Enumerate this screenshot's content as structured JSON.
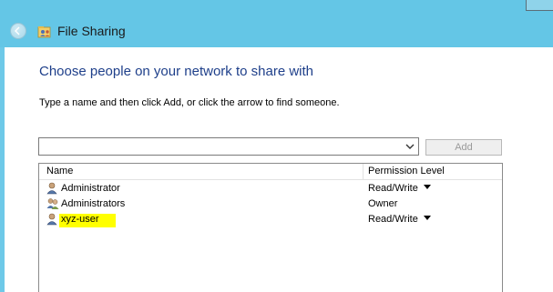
{
  "window": {
    "title": "File Sharing",
    "icon": "file-sharing-icon",
    "back_icon": "back-arrow-icon"
  },
  "dialog": {
    "heading": "Choose people on your network to share with",
    "instructions": "Type a name and then click Add, or click the arrow to find someone.",
    "name_input": {
      "value": "",
      "placeholder": ""
    },
    "add_label": "Add"
  },
  "list": {
    "columns": [
      "Name",
      "Permission Level"
    ],
    "rows": [
      {
        "name": "Administrator",
        "permission": "Read/Write",
        "icon": "user-icon",
        "has_dropdown": true,
        "highlighted": false
      },
      {
        "name": "Administrators",
        "permission": "Owner",
        "icon": "group-icon",
        "has_dropdown": false,
        "highlighted": false
      },
      {
        "name": "xyz-user",
        "permission": "Read/Write",
        "icon": "user-icon",
        "has_dropdown": true,
        "highlighted": true
      }
    ]
  },
  "colors": {
    "titlebar": "#64c6e6",
    "heading": "#1e3f8a",
    "highlight": "#ffff00"
  }
}
